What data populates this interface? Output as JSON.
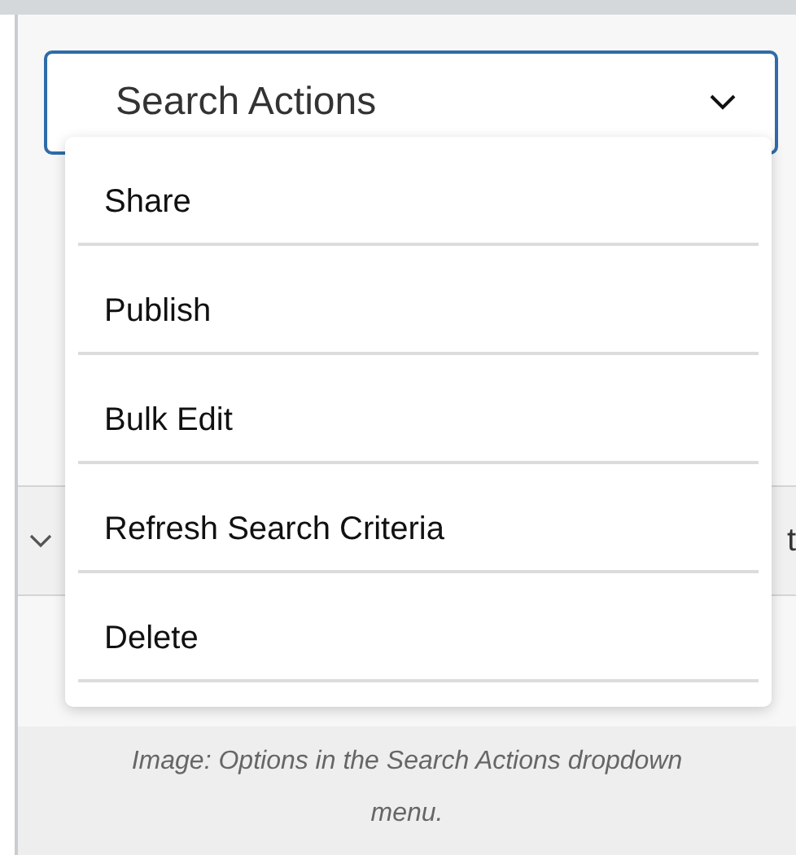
{
  "select": {
    "label": "Search Actions",
    "expanded": true
  },
  "menu": {
    "items": [
      {
        "label": "Share"
      },
      {
        "label": "Publish"
      },
      {
        "label": "Bulk Edit"
      },
      {
        "label": "Refresh Search Criteria"
      },
      {
        "label": "Delete"
      }
    ]
  },
  "background_table": {
    "column_2": "t"
  },
  "caption": "Image: Options in the Search Actions dropdown menu."
}
